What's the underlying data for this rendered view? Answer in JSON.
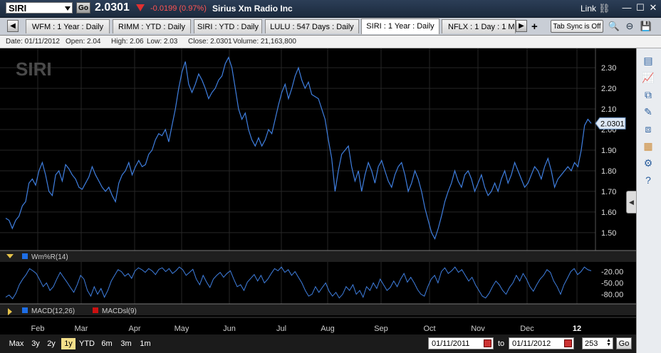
{
  "header": {
    "symbol": "SIRI",
    "go_label": "Go",
    "price": "2.0301",
    "change": "-0.0199 (0.97%)",
    "company": "Sirius Xm Radio Inc",
    "link_label": "Link",
    "down_color": "#e03030"
  },
  "tabs": {
    "items": [
      {
        "label": "WFM : 1 Year : Daily"
      },
      {
        "label": "RIMM : YTD : Daily"
      },
      {
        "label": "SIRI : YTD : Daily"
      },
      {
        "label": "LULU : 547  Days : Daily"
      },
      {
        "label": "SIRI : 1 Year : Daily",
        "active": true
      },
      {
        "label": "NFLX : 1 Day : 1 Mi"
      }
    ],
    "plus_label": "+",
    "sync_label": "Tab Sync is Off"
  },
  "info": {
    "date": "Date: 01/11/2012",
    "open": "Open: 2.04",
    "high": "High: 2.06",
    "low": "Low: 2.03",
    "close": "Close: 2.0301",
    "volume": "Volume: 21,163,800"
  },
  "chart_data": {
    "type": "line",
    "title": "SIRI",
    "price_panel": {
      "ylim": [
        1.42,
        2.38
      ],
      "yticks": [
        "2.30",
        "2.20",
        "2.10",
        "2.00",
        "1.90",
        "1.80",
        "1.70",
        "1.60",
        "1.50"
      ],
      "last_value_label": "2.0301",
      "line_color": "#3f7fe0",
      "series": [
        {
          "values": [
            1.57,
            1.56,
            1.52,
            1.56,
            1.58,
            1.63,
            1.65,
            1.74,
            1.76,
            1.73,
            1.8,
            1.84,
            1.78,
            1.7,
            1.68,
            1.78,
            1.8,
            1.75,
            1.83,
            1.81,
            1.78,
            1.76,
            1.72,
            1.71,
            1.74,
            1.77,
            1.82,
            1.78,
            1.75,
            1.72,
            1.7,
            1.72,
            1.68,
            1.65,
            1.74,
            1.78,
            1.8,
            1.84,
            1.78,
            1.82,
            1.85,
            1.82,
            1.83,
            1.88,
            1.9,
            1.95,
            1.98,
            1.97,
            2.0,
            1.94,
            2.02,
            2.1,
            2.2,
            2.28,
            2.33,
            2.22,
            2.18,
            2.22,
            2.27,
            2.24,
            2.2,
            2.15,
            2.18,
            2.2,
            2.24,
            2.26,
            2.32,
            2.35,
            2.3,
            2.2,
            2.1,
            2.05,
            2.08,
            2.0,
            1.95,
            1.92,
            1.96,
            1.92,
            1.95,
            2.0,
            1.98,
            2.05,
            2.12,
            2.18,
            2.22,
            2.15,
            2.2,
            2.26,
            2.3,
            2.24,
            2.2,
            2.23,
            2.17,
            2.16,
            2.15,
            2.1,
            2.05,
            1.95,
            1.86,
            1.7,
            1.8,
            1.88,
            1.9,
            1.92,
            1.82,
            1.75,
            1.8,
            1.7,
            1.78,
            1.84,
            1.8,
            1.74,
            1.82,
            1.85,
            1.8,
            1.75,
            1.72,
            1.78,
            1.82,
            1.84,
            1.78,
            1.7,
            1.74,
            1.8,
            1.76,
            1.7,
            1.62,
            1.56,
            1.5,
            1.47,
            1.52,
            1.58,
            1.65,
            1.7,
            1.74,
            1.8,
            1.75,
            1.72,
            1.78,
            1.8,
            1.76,
            1.7,
            1.74,
            1.78,
            1.72,
            1.68,
            1.7,
            1.74,
            1.7,
            1.76,
            1.8,
            1.74,
            1.78,
            1.84,
            1.8,
            1.76,
            1.72,
            1.74,
            1.78,
            1.82,
            1.8,
            1.76,
            1.82,
            1.86,
            1.8,
            1.72,
            1.76,
            1.78,
            1.8,
            1.82,
            1.8,
            1.84,
            1.82,
            1.9,
            2.02,
            2.05,
            2.03
          ]
        }
      ]
    },
    "wmr_panel": {
      "legend": "Wm%R(14)",
      "legend_color": "#1e6ee6",
      "ylim": [
        -100,
        0
      ],
      "yticks": [
        "-20.00",
        "-50.00",
        "-80.00"
      ],
      "series": [
        {
          "values": [
            -88,
            -82,
            -92,
            -78,
            -55,
            -40,
            -28,
            -12,
            -18,
            -25,
            -42,
            -60,
            -50,
            -70,
            -60,
            -40,
            -22,
            -35,
            -48,
            -62,
            -75,
            -55,
            -30,
            -40,
            -70,
            -85,
            -60,
            -80,
            -65,
            -88,
            -70,
            -45,
            -30,
            -15,
            -20,
            -32,
            -25,
            -38,
            -18,
            -10,
            -15,
            -22,
            -12,
            -18,
            -28,
            -14,
            -10,
            -20,
            -12,
            -25,
            -18,
            -8,
            -15,
            -30,
            -22,
            -14,
            -40,
            -55,
            -30,
            -48,
            -62,
            -40,
            -30,
            -22,
            -35,
            -25,
            -18,
            -40,
            -60,
            -55,
            -70,
            -48,
            -38,
            -28,
            -45,
            -30,
            -50,
            -40,
            -25,
            -12,
            -18,
            -8,
            -22,
            -15,
            -30,
            -20,
            -35,
            -50,
            -70,
            -85,
            -80,
            -60,
            -75,
            -62,
            -50,
            -72,
            -85,
            -75,
            -90,
            -80,
            -60,
            -70,
            -55,
            -80,
            -70,
            -88,
            -60,
            -70,
            -50,
            -65,
            -40,
            -55,
            -70,
            -62,
            -45,
            -60,
            -40,
            -25,
            -48,
            -35,
            -50,
            -68,
            -80,
            -85,
            -60,
            -40,
            -30,
            -50,
            -20,
            -10,
            -25,
            -18,
            -8,
            -22,
            -15,
            -30,
            -45,
            -35,
            -55,
            -70,
            -85,
            -90,
            -78,
            -60,
            -45,
            -55,
            -70,
            -80,
            -62,
            -50,
            -30,
            -45,
            -25,
            -40,
            -60,
            -72,
            -55,
            -40,
            -30,
            -15,
            -22,
            -45,
            -60,
            -80,
            -55,
            -38,
            -20,
            -12,
            -28,
            -20,
            -8,
            -15,
            -18
          ]
        }
      ]
    },
    "macd_panel": {
      "legend": "MACD(12,26)",
      "legend_color": "#1e6ee6",
      "legend2": "MACDsl(9)",
      "legend2_color": "#cc1111"
    },
    "x_tick_labels": [
      "Feb",
      "Mar",
      "Apr",
      "May",
      "Jun",
      "Jul",
      "Aug",
      "Sep",
      "Oct",
      "Nov",
      "Dec",
      "12"
    ]
  },
  "range_buttons": [
    {
      "label": "Max"
    },
    {
      "label": "3y"
    },
    {
      "label": "2y"
    },
    {
      "label": "1y",
      "active": true
    },
    {
      "label": "YTD"
    },
    {
      "label": "6m"
    },
    {
      "label": "3m"
    },
    {
      "label": "1m"
    }
  ],
  "date_range": {
    "from": "01/11/2011",
    "to_label": "to",
    "to": "01/11/2012",
    "count": "253",
    "go_label": "Go"
  }
}
